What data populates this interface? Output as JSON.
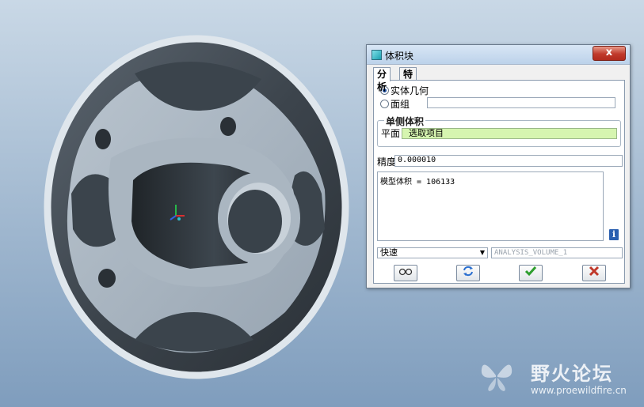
{
  "dialog": {
    "title": "体积块",
    "close_label": "x",
    "tabs": [
      {
        "label": "分析",
        "active": true
      },
      {
        "label": "特征",
        "active": false
      }
    ],
    "radio_solid": "实体几何",
    "radio_quilt": "面组",
    "group_title": "单侧体积",
    "plane_label": "平面",
    "plane_value": "选取项目",
    "precision_label": "精度",
    "precision_value": "0.000010",
    "result_text": "模型体积 = 106133",
    "info_icon": "i",
    "mode_select": "快速",
    "analysis_name": "ANALYSIS_VOLUME_1",
    "buttons": {
      "glasses": "glasses-icon",
      "repeat": "repeat-icon",
      "ok": "check-icon",
      "cancel": "cancel-icon"
    }
  },
  "watermark": {
    "name": "野火论坛",
    "url": "www.proewildfire.cn"
  },
  "colors": {
    "background_top": "#c9d8e6",
    "background_bottom": "#7f9dbd",
    "part": "#a7b4c0",
    "plane_field": "#d6f5b0",
    "ok_green": "#2e9e2e",
    "cancel_red": "#c0392b"
  }
}
